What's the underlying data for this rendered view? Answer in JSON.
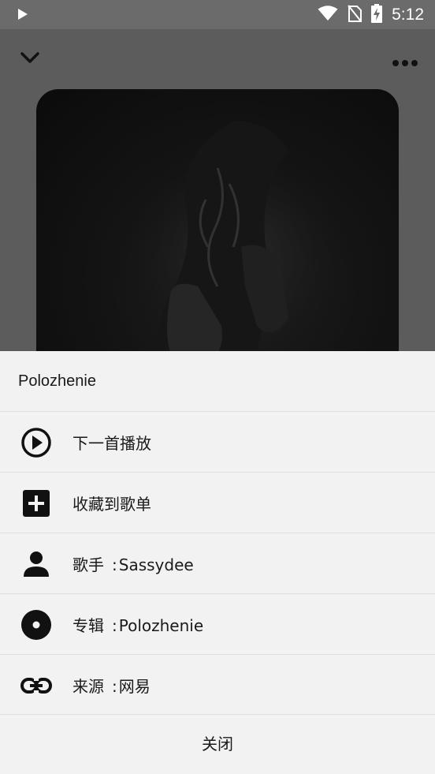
{
  "status_bar": {
    "time": "5:12",
    "icons": [
      "play-indicator-icon",
      "wifi-icon",
      "no-sim-icon",
      "battery-charging-icon"
    ]
  },
  "player": {
    "collapse_icon": "chevron-down-icon",
    "more_icon": "more-horizontal-icon"
  },
  "sheet": {
    "title": "Polozhenie",
    "items": [
      {
        "icon": "play-circle-icon",
        "label": "下一首播放"
      },
      {
        "icon": "add-box-icon",
        "label": "收藏到歌单"
      },
      {
        "icon": "person-icon",
        "label": "歌手",
        "value": "Sassydee"
      },
      {
        "icon": "disc-icon",
        "label": "专辑",
        "value": "Polozhenie"
      },
      {
        "icon": "link-icon",
        "label": "来源",
        "value": "网易"
      }
    ],
    "separator": ":",
    "close_label": "关闭"
  }
}
